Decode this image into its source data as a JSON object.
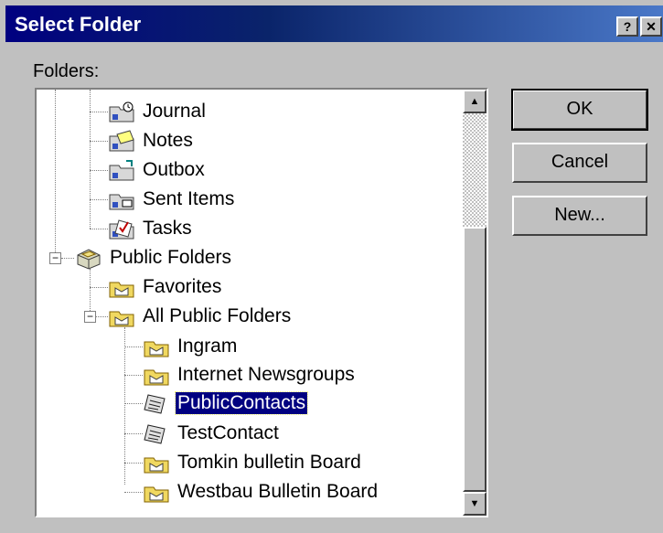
{
  "window": {
    "title": "Select Folder",
    "help_btn": "?",
    "close_btn": "✕"
  },
  "folders_label": "Folders:",
  "tree": {
    "items": [
      {
        "label": "Journal",
        "icon": "journal-folder-icon"
      },
      {
        "label": "Notes",
        "icon": "notes-folder-icon"
      },
      {
        "label": "Outbox",
        "icon": "outbox-folder-icon"
      },
      {
        "label": "Sent Items",
        "icon": "sent-items-folder-icon"
      },
      {
        "label": "Tasks",
        "icon": "tasks-folder-icon"
      },
      {
        "label": "Public Folders",
        "icon": "public-folders-icon",
        "expander": "−"
      },
      {
        "label": "Favorites",
        "icon": "favorites-folder-icon"
      },
      {
        "label": "All Public Folders",
        "icon": "all-public-folders-icon",
        "expander": "−"
      },
      {
        "label": "Ingram",
        "icon": "mail-folder-icon"
      },
      {
        "label": "Internet Newsgroups",
        "icon": "mail-folder-icon"
      },
      {
        "label": "PublicContacts",
        "icon": "contacts-folder-icon",
        "selected": true
      },
      {
        "label": "TestContact",
        "icon": "contacts-folder-icon"
      },
      {
        "label": "Tomkin bulletin Board",
        "icon": "mail-folder-icon"
      },
      {
        "label": "Westbau Bulletin Board",
        "icon": "mail-folder-icon"
      }
    ]
  },
  "scrollbar": {
    "up": "▲",
    "down": "▼"
  },
  "buttons": {
    "ok": "OK",
    "cancel": "Cancel",
    "new": "New..."
  }
}
